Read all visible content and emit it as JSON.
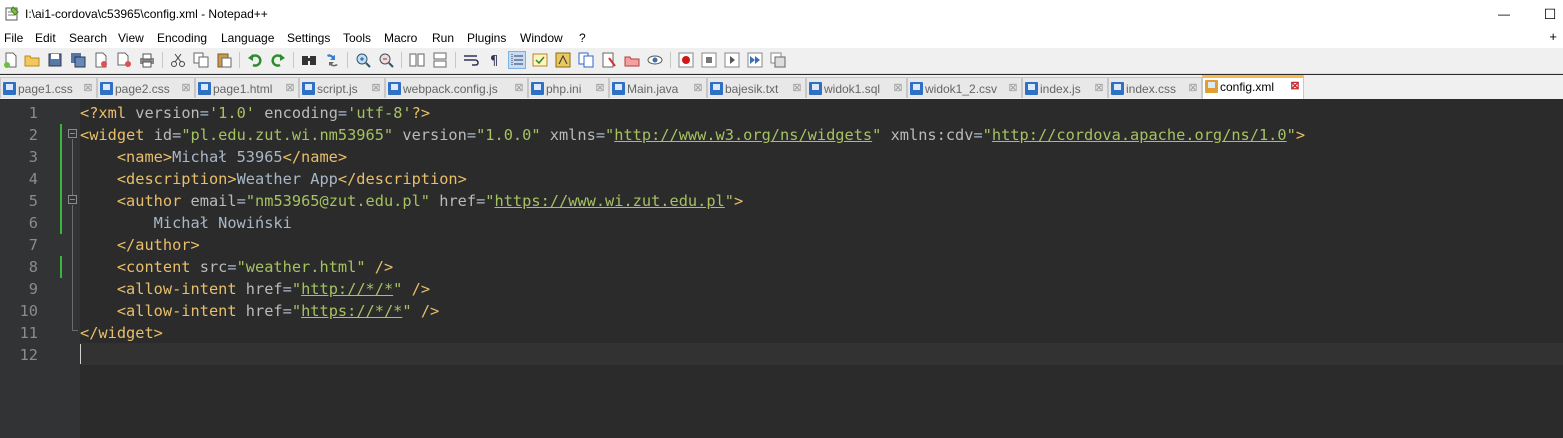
{
  "window": {
    "title": "I:\\ai1-cordova\\c53965\\config.xml - Notepad++",
    "app_icon": "notepad-plus-plus-icon",
    "minimize_glyph": "—",
    "maximize_glyph": "☐"
  },
  "menu": {
    "items": [
      "File",
      "Edit",
      "Search",
      "View",
      "Encoding",
      "Language",
      "Settings",
      "Tools",
      "Macro",
      "Run",
      "Plugins",
      "Window",
      "?"
    ],
    "plus": "+"
  },
  "toolbar": {
    "icons": [
      "new-file-icon",
      "open-file-icon",
      "save-icon",
      "save-all-icon",
      "close-icon",
      "close-all-icon",
      "print-icon",
      "cut-icon",
      "copy-icon",
      "paste-icon",
      "undo-icon",
      "redo-icon",
      "find-icon",
      "replace-icon",
      "zoom-in-icon",
      "zoom-out-icon",
      "sync-vertical-icon",
      "sync-horizontal-icon",
      "word-wrap-icon",
      "show-all-characters-icon",
      "indent-guide-icon",
      "user-language-icon",
      "document-map-icon",
      "function-list-icon",
      "folder-as-workspace-icon",
      "monitoring-icon",
      "record-macro-icon",
      "stop-recording-icon",
      "playback-macro-icon",
      "run-macro-multiple-icon",
      "save-macro-icon"
    ]
  },
  "tabs": [
    {
      "label": "page1.css",
      "active": false
    },
    {
      "label": "page2.css",
      "active": false
    },
    {
      "label": "page1.html",
      "active": false
    },
    {
      "label": "script.js",
      "active": false
    },
    {
      "label": "webpack.config.js",
      "active": false
    },
    {
      "label": "php.ini",
      "active": false
    },
    {
      "label": "Main.java",
      "active": false
    },
    {
      "label": "bajesik.txt",
      "active": false
    },
    {
      "label": "widok1.sql",
      "active": false
    },
    {
      "label": "widok1_2.csv",
      "active": false
    },
    {
      "label": "index.js",
      "active": false
    },
    {
      "label": "index.css",
      "active": false
    },
    {
      "label": "config.xml",
      "active": true
    }
  ],
  "editor": {
    "line_numbers": [
      "1",
      "2",
      "3",
      "4",
      "5",
      "6",
      "7",
      "8",
      "9",
      "10",
      "11",
      "12"
    ],
    "colors": {
      "tag": "#e8bf6a",
      "attribute": "#bababa",
      "value": "#a5c261",
      "text": "#a9b7c6",
      "background": "#2b2b2b",
      "change_marker": "#3cb43c"
    },
    "lines": [
      [
        [
          "tag",
          "<?xml "
        ],
        [
          "attr",
          "version"
        ],
        [
          "text",
          "="
        ],
        [
          "val",
          "'1.0'"
        ],
        [
          "text",
          " "
        ],
        [
          "attr",
          "encoding"
        ],
        [
          "text",
          "="
        ],
        [
          "val",
          "'utf-8'"
        ],
        [
          "tag",
          "?>"
        ]
      ],
      [
        [
          "tag",
          "<widget "
        ],
        [
          "attr",
          "id"
        ],
        [
          "text",
          "="
        ],
        [
          "val",
          "\"pl.edu.zut.wi.nm53965\""
        ],
        [
          "text",
          " "
        ],
        [
          "attr",
          "version"
        ],
        [
          "text",
          "="
        ],
        [
          "val",
          "\"1.0.0\""
        ],
        [
          "text",
          " "
        ],
        [
          "attr",
          "xmlns"
        ],
        [
          "text",
          "="
        ],
        [
          "val",
          "\""
        ],
        [
          "url",
          "http://www.w3.org/ns/widgets"
        ],
        [
          "val",
          "\""
        ],
        [
          "text",
          " "
        ],
        [
          "attr",
          "xmlns:cdv"
        ],
        [
          "text",
          "="
        ],
        [
          "val",
          "\""
        ],
        [
          "url",
          "http://cordova.apache.org/ns/1.0"
        ],
        [
          "val",
          "\""
        ],
        [
          "tag",
          ">"
        ]
      ],
      [
        [
          "text",
          "    "
        ],
        [
          "tag",
          "<name>"
        ],
        [
          "text",
          "Michał 53965"
        ],
        [
          "tag",
          "</name>"
        ]
      ],
      [
        [
          "text",
          "    "
        ],
        [
          "tag",
          "<description>"
        ],
        [
          "text",
          "Weather App"
        ],
        [
          "tag",
          "</description>"
        ]
      ],
      [
        [
          "text",
          "    "
        ],
        [
          "tag",
          "<author "
        ],
        [
          "attr",
          "email"
        ],
        [
          "text",
          "="
        ],
        [
          "val",
          "\"nm53965@zut.edu.pl\""
        ],
        [
          "text",
          " "
        ],
        [
          "attr",
          "href"
        ],
        [
          "text",
          "="
        ],
        [
          "val",
          "\""
        ],
        [
          "url",
          "https://www.wi.zut.edu.pl"
        ],
        [
          "val",
          "\""
        ],
        [
          "tag",
          ">"
        ]
      ],
      [
        [
          "text",
          "        Michał Nowiński"
        ]
      ],
      [
        [
          "text",
          "    "
        ],
        [
          "tag",
          "</author>"
        ]
      ],
      [
        [
          "text",
          "    "
        ],
        [
          "tag",
          "<content "
        ],
        [
          "attr",
          "src"
        ],
        [
          "text",
          "="
        ],
        [
          "val",
          "\"weather.html\""
        ],
        [
          "text",
          " "
        ],
        [
          "tag",
          "/>"
        ]
      ],
      [
        [
          "text",
          "    "
        ],
        [
          "tag",
          "<allow-intent "
        ],
        [
          "attr",
          "href"
        ],
        [
          "text",
          "="
        ],
        [
          "val",
          "\""
        ],
        [
          "url",
          "http://*/*"
        ],
        [
          "val",
          "\""
        ],
        [
          "text",
          " "
        ],
        [
          "tag",
          "/>"
        ]
      ],
      [
        [
          "text",
          "    "
        ],
        [
          "tag",
          "<allow-intent "
        ],
        [
          "attr",
          "href"
        ],
        [
          "text",
          "="
        ],
        [
          "val",
          "\""
        ],
        [
          "url",
          "https://*/*"
        ],
        [
          "val",
          "\""
        ],
        [
          "text",
          " "
        ],
        [
          "tag",
          "/>"
        ]
      ],
      [
        [
          "tag",
          "</widget>"
        ]
      ],
      []
    ]
  }
}
